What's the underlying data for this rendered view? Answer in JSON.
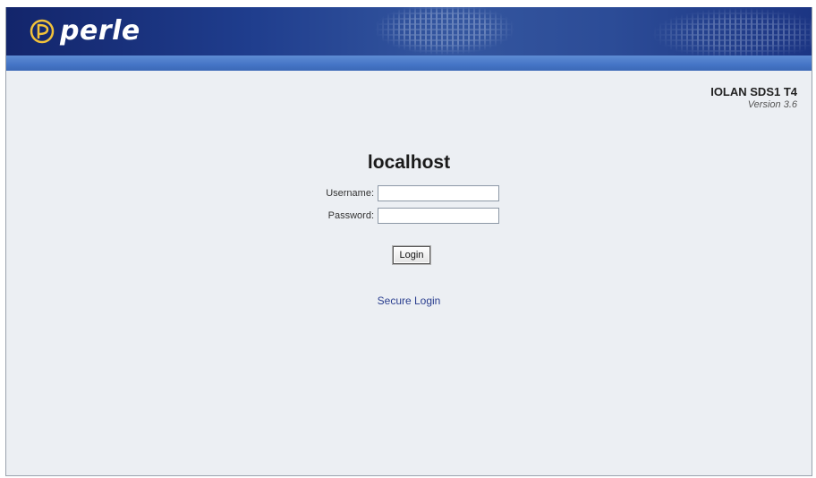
{
  "header": {
    "brand": "perle",
    "colors": {
      "header_dark": "#13256b",
      "stripe": "#4575c6",
      "page_bg": "#eceff3"
    }
  },
  "product": {
    "name": "IOLAN SDS1 T4",
    "version": "Version 3.6"
  },
  "login": {
    "host": "localhost",
    "username_label": "Username:",
    "username_value": "",
    "password_label": "Password:",
    "password_value": "",
    "login_button": "Login",
    "secure_login_link": "Secure Login"
  },
  "icons": {
    "logo": "perle-logo-icon"
  }
}
